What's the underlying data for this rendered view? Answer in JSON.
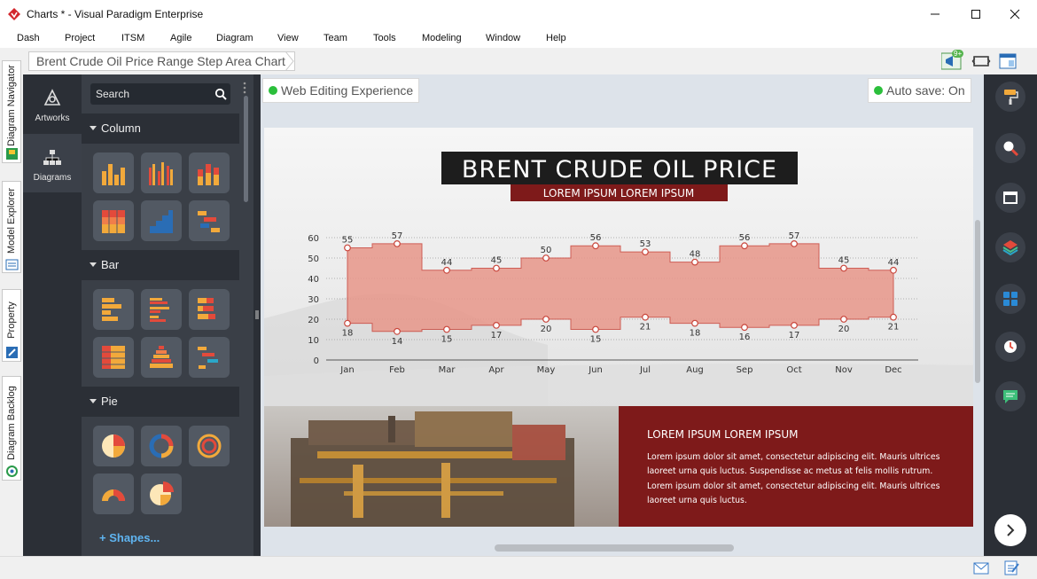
{
  "window": {
    "title": "Charts * - Visual Paradigm Enterprise"
  },
  "menu": [
    "Dash",
    "Project",
    "ITSM",
    "Agile",
    "Diagram",
    "View",
    "Team",
    "Tools",
    "Modeling",
    "Window",
    "Help"
  ],
  "left_tabs": [
    "Diagram Navigator",
    "Model Explorer",
    "Property",
    "Diagram Backlog"
  ],
  "breadcrumb": "Brent Crude Oil Price Range Step Area Chart",
  "notification_badge": "9+",
  "nav": {
    "artworks": "Artworks",
    "diagrams": "Diagrams"
  },
  "search": {
    "placeholder": "Search"
  },
  "sections": {
    "column": "Column",
    "bar": "Bar",
    "pie": "Pie"
  },
  "shapes_link": "+ Shapes...",
  "canvas": {
    "web_editing": "Web Editing Experience",
    "auto_save": "Auto save: On"
  },
  "poster": {
    "title": "BRENT CRUDE OIL PRICE",
    "subtitle": "LOREM IPSUM LOREM IPSUM",
    "info_heading": "LOREM IPSUM LOREM IPSUM",
    "info_lines": [
      "Lorem ipsum dolor sit amet, consectetur adipiscing elit. Mauris ultrices",
      "laoreet urna quis luctus. Suspendisse ac metus at felis mollis rutrum.",
      "Lorem ipsum dolor sit amet, consectetur adipiscing elit. Mauris ultrices",
      "laoreet urna quis luctus."
    ]
  },
  "colors": {
    "accent": "#7e1a1a",
    "area": "#e8978a",
    "panel": "#3a3f47",
    "status_green": "#2bbf3b"
  },
  "chart_data": {
    "type": "area",
    "title": "BRENT CRUDE OIL PRICE",
    "subtitle": "LOREM IPSUM LOREM IPSUM",
    "categories": [
      "Jan",
      "Feb",
      "Mar",
      "Apr",
      "May",
      "Jun",
      "Jul",
      "Aug",
      "Sep",
      "Oct",
      "Nov",
      "Dec"
    ],
    "series": [
      {
        "name": "",
        "values": [
          55,
          57,
          44,
          45,
          50,
          56,
          53,
          48,
          56,
          57,
          45,
          44
        ]
      },
      {
        "name": "",
        "values": [
          18,
          14,
          15,
          17,
          20,
          15,
          21,
          18,
          16,
          17,
          20,
          21
        ]
      }
    ],
    "ylim": [
      0,
      60
    ],
    "yticks": [
      0,
      10,
      20,
      30,
      40,
      50,
      60
    ],
    "grid": true,
    "step": true,
    "xlabel": "",
    "ylabel": ""
  }
}
